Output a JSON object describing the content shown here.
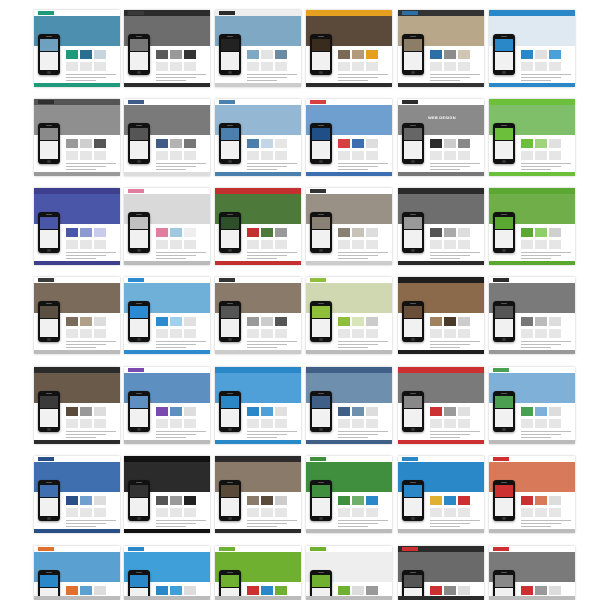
{
  "gallery": {
    "tiles": [
      {
        "brand": "",
        "hero_title": "",
        "header": "#ffffff",
        "hero": "#4d8fae",
        "accent": "#1e9a7a",
        "screen": "#6fa0c0",
        "blocks": [
          "#1e9a7a",
          "#2a6f8f",
          "#c7d5de"
        ],
        "footer": "#1e9a7a",
        "phone": "left"
      },
      {
        "brand": "",
        "hero_title": "",
        "header": "#2b2b2b",
        "hero": "#6d6d6d",
        "accent": "#3a3a3a",
        "screen": "#777777",
        "blocks": [
          "#5a5a5a",
          "#9a9a9a",
          "#333333"
        ],
        "footer": "#2b2b2b",
        "phone": "left"
      },
      {
        "brand": "",
        "hero_title": "",
        "header": "#eeeeee",
        "hero": "#7fa8c5",
        "accent": "#2b2b2b",
        "screen": "#222222",
        "blocks": [
          "#7fa8c5",
          "#e3e3e3",
          "#6c8ba2"
        ],
        "footer": "#cccccc",
        "phone": "left"
      },
      {
        "brand": "",
        "hero_title": "",
        "header": "#e5a020",
        "hero": "#5b4a3a",
        "accent": "#e5a020",
        "screen": "#3a2b1f",
        "blocks": [
          "#7a6a55",
          "#b39a7a",
          "#e5a020"
        ],
        "footer": "#2b2b2b",
        "phone": "left"
      },
      {
        "brand": "",
        "hero_title": "",
        "header": "#333333",
        "hero": "#b8a789",
        "accent": "#2b6fa6",
        "screen": "#8c7d66",
        "blocks": [
          "#2b6fa6",
          "#8c8c8c",
          "#d0c6b3"
        ],
        "footer": "#333333",
        "phone": "left"
      },
      {
        "brand": "",
        "hero_title": "",
        "header": "#2b88c8",
        "hero": "#dfe9f2",
        "accent": "#2b88c8",
        "screen": "#2b88c8",
        "blocks": [
          "#2b88c8",
          "#e0e0e0",
          "#4aa0d8"
        ],
        "footer": "#2b88c8",
        "phone": "left"
      },
      {
        "brand": "",
        "hero_title": "",
        "header": "#555555",
        "hero": "#8f8f8f",
        "accent": "#2f2f2f",
        "screen": "#8a8a8a",
        "blocks": [
          "#9a9a9a",
          "#cfcfcf",
          "#555555"
        ],
        "footer": "#999999",
        "phone": "left"
      },
      {
        "brand": "",
        "hero_title": "",
        "header": "#ffffff",
        "hero": "#7a7a7a",
        "accent": "#3f5b86",
        "screen": "#555555",
        "blocks": [
          "#3f5b86",
          "#b3b3b3",
          "#777777"
        ],
        "footer": "#dddddd",
        "phone": "left"
      },
      {
        "brand": "",
        "hero_title": "",
        "header": "#ffffff",
        "hero": "#94b8d3",
        "accent": "#4a7fae",
        "screen": "#4a7fae",
        "blocks": [
          "#4a7fae",
          "#c2d6e6",
          "#e6e6e6"
        ],
        "footer": "#4a7fae",
        "phone": "left"
      },
      {
        "brand": "",
        "hero_title": "",
        "header": "#ffffff",
        "hero": "#6f9fcf",
        "accent": "#d64040",
        "screen": "#1f4f86",
        "blocks": [
          "#d64040",
          "#3d6fb0",
          "#dddddd"
        ],
        "footer": "#3d6fb0",
        "phone": "left"
      },
      {
        "brand": "",
        "hero_title": "WEB DESIGN",
        "header": "#ffffff",
        "hero": "#8a8a8a",
        "accent": "#2b2b2b",
        "screen": "#666666",
        "blocks": [
          "#2b2b2b",
          "#cccccc",
          "#888888"
        ],
        "footer": "#777777",
        "phone": "left"
      },
      {
        "brand": "",
        "hero_title": "",
        "header": "#6cbf3a",
        "hero": "#7fbf6a",
        "accent": "#6cbf3a",
        "screen": "#6cbf3a",
        "blocks": [
          "#6cbf3a",
          "#9fd47c",
          "#e0e0e0"
        ],
        "footer": "#6cbf3a",
        "phone": "left"
      },
      {
        "brand": "",
        "hero_title": "",
        "header": "#3f3f8f",
        "hero": "#4a56a8",
        "accent": "#3f3f8f",
        "screen": "#4a56a8",
        "blocks": [
          "#4a56a8",
          "#8c9ad0",
          "#c8ccea"
        ],
        "footer": "#3f3f8f",
        "phone": "left"
      },
      {
        "brand": "",
        "hero_title": "",
        "header": "#ffffff",
        "hero": "#d9d9d9",
        "accent": "#e07ea0",
        "screen": "#c0c0c0",
        "blocks": [
          "#e07ea0",
          "#a0c8e0",
          "#eeeeee"
        ],
        "footer": "#bbbbbb",
        "phone": "left"
      },
      {
        "brand": "",
        "hero_title": "",
        "header": "#c23030",
        "hero": "#4d7a3a",
        "accent": "#c23030",
        "screen": "#2f4f2a",
        "blocks": [
          "#c23030",
          "#4d7a3a",
          "#999999"
        ],
        "footer": "#c23030",
        "phone": "left"
      },
      {
        "brand": "",
        "hero_title": "",
        "header": "#ffffff",
        "hero": "#9a9186",
        "accent": "#333333",
        "screen": "#8a8175",
        "blocks": [
          "#8a8175",
          "#c8c2b8",
          "#dddddd"
        ],
        "footer": "#cccccc",
        "phone": "left"
      },
      {
        "brand": "",
        "hero_title": "",
        "header": "#2b2b2b",
        "hero": "#6e6e6e",
        "accent": "#2b2b2b",
        "screen": "#999999",
        "blocks": [
          "#555555",
          "#aaaaaa",
          "#dddddd"
        ],
        "footer": "#2b2b2b",
        "phone": "left"
      },
      {
        "brand": "",
        "hero_title": "",
        "header": "#5aa832",
        "hero": "#6fae48",
        "accent": "#5aa832",
        "screen": "#5aa832",
        "blocks": [
          "#5aa832",
          "#8fcf6a",
          "#d0d0d0"
        ],
        "footer": "#5aa832",
        "phone": "left"
      },
      {
        "brand": "",
        "hero_title": "",
        "header": "#ffffff",
        "hero": "#7a6b5a",
        "accent": "#3a3a3a",
        "screen": "#5a4f42",
        "blocks": [
          "#7a6b5a",
          "#b0a08a",
          "#dddddd"
        ],
        "footer": "#bbbbbb",
        "phone": "left"
      },
      {
        "brand": "",
        "hero_title": "",
        "header": "#ffffff",
        "hero": "#6fb0d8",
        "accent": "#2b8ad0",
        "screen": "#2b8ad0",
        "blocks": [
          "#2b8ad0",
          "#9fd0ee",
          "#e0e0e0"
        ],
        "footer": "#2b8ad0",
        "phone": "left"
      },
      {
        "brand": "",
        "hero_title": "",
        "header": "#ffffff",
        "hero": "#8a7a6a",
        "accent": "#333333",
        "screen": "#555555",
        "blocks": [
          "#999999",
          "#cccccc",
          "#555555"
        ],
        "footer": "#cccccc",
        "phone": "left"
      },
      {
        "brand": "",
        "hero_title": "",
        "header": "#ffffff",
        "hero": "#cfd8b0",
        "accent": "#8fbf3a",
        "screen": "#8fbf3a",
        "blocks": [
          "#8fbf3a",
          "#d8e5b8",
          "#cccccc"
        ],
        "footer": "#bbbbbb",
        "phone": "left"
      },
      {
        "brand": "",
        "hero_title": "",
        "header": "#1f1f1f",
        "hero": "#8a6a4a",
        "accent": "#1f1f1f",
        "screen": "#6a4f38",
        "blocks": [
          "#a0825f",
          "#4a3a2a",
          "#cccccc"
        ],
        "footer": "#1f1f1f",
        "phone": "left"
      },
      {
        "brand": "",
        "hero_title": "",
        "header": "#ffffff",
        "hero": "#7a7a7a",
        "accent": "#2b2b2b",
        "screen": "#555555",
        "blocks": [
          "#777777",
          "#bbbbbb",
          "#dddddd"
        ],
        "footer": "#999999",
        "phone": "left"
      },
      {
        "brand": "",
        "hero_title": "",
        "header": "#2b2b2b",
        "hero": "#6a5a4a",
        "accent": "#2b2b2b",
        "screen": "#3a3a3a",
        "blocks": [
          "#5a4a3a",
          "#999999",
          "#dddddd"
        ],
        "footer": "#2b2b2b",
        "phone": "left"
      },
      {
        "brand": "",
        "hero_title": "",
        "header": "#ffffff",
        "hero": "#5d8fc0",
        "accent": "#7a4ab0",
        "screen": "#5d8fc0",
        "blocks": [
          "#7a4ab0",
          "#5d8fc0",
          "#dddddd"
        ],
        "footer": "#bbbbbb",
        "phone": "left"
      },
      {
        "brand": "",
        "hero_title": "",
        "header": "#2b88c8",
        "hero": "#4fa0d8",
        "accent": "#2b88c8",
        "screen": "#2b88c8",
        "blocks": [
          "#2b88c8",
          "#4fa0d8",
          "#e0e0e0"
        ],
        "footer": "#2b88c8",
        "phone": "left"
      },
      {
        "brand": "",
        "hero_title": "",
        "header": "#3f5f86",
        "hero": "#6f8faf",
        "accent": "#3f5f86",
        "screen": "#3f5f86",
        "blocks": [
          "#3f5f86",
          "#6f8faf",
          "#dddddd"
        ],
        "footer": "#3f5f86",
        "phone": "left"
      },
      {
        "brand": "",
        "hero_title": "",
        "header": "#cc3030",
        "hero": "#7a7a7a",
        "accent": "#cc3030",
        "screen": "#888888",
        "blocks": [
          "#cc3030",
          "#9a9a9a",
          "#e0e0e0"
        ],
        "footer": "#cc3030",
        "phone": "left"
      },
      {
        "brand": "",
        "hero_title": "",
        "header": "#ffffff",
        "hero": "#7fb0d8",
        "accent": "#4aa050",
        "screen": "#4aa050",
        "blocks": [
          "#4aa050",
          "#7fb0d8",
          "#dddddd"
        ],
        "footer": "#bbbbbb",
        "phone": "left"
      },
      {
        "brand": "",
        "hero_title": "",
        "header": "#ffffff",
        "hero": "#3f6fae",
        "accent": "#2a4f86",
        "screen": "#3f6fae",
        "blocks": [
          "#2a4f86",
          "#6f9fcf",
          "#dddddd"
        ],
        "footer": "#2a4f86",
        "phone": "left"
      },
      {
        "brand": "",
        "hero_title": "",
        "header": "#111111",
        "hero": "#2b2b2b",
        "accent": "#111111",
        "screen": "#333333",
        "blocks": [
          "#555555",
          "#999999",
          "#222222"
        ],
        "footer": "#111111",
        "phone": "left"
      },
      {
        "brand": "",
        "hero_title": "",
        "header": "#2b2b2b",
        "hero": "#8a7a6a",
        "accent": "#2b2b2b",
        "screen": "#5a4a3a",
        "blocks": [
          "#8a7a6a",
          "#5a4a3a",
          "#cccccc"
        ],
        "footer": "#2b2b2b",
        "phone": "left"
      },
      {
        "brand": "",
        "hero_title": "",
        "header": "#ffffff",
        "hero": "#3f8f3f",
        "accent": "#3f8f3f",
        "screen": "#3f8f3f",
        "blocks": [
          "#3f8f3f",
          "#6faf6a",
          "#2b88c8"
        ],
        "footer": "#bbbbbb",
        "phone": "left"
      },
      {
        "brand": "",
        "hero_title": "",
        "header": "#ffffff",
        "hero": "#2b88c8",
        "accent": "#2b88c8",
        "screen": "#2b88c8",
        "blocks": [
          "#e0b030",
          "#2b88c8",
          "#cc3030"
        ],
        "footer": "#bbbbbb",
        "phone": "left"
      },
      {
        "brand": "",
        "hero_title": "",
        "header": "#ffffff",
        "hero": "#d87a5a",
        "accent": "#cc3030",
        "screen": "#cc3030",
        "blocks": [
          "#cc3030",
          "#d87a5a",
          "#dddddd"
        ],
        "footer": "#bbbbbb",
        "phone": "left"
      },
      {
        "brand": "",
        "hero_title": "",
        "header": "#ffffff",
        "hero": "#5aa0d0",
        "accent": "#e07030",
        "screen": "#2b88c8",
        "blocks": [
          "#e07030",
          "#5aa0d0",
          "#dddddd"
        ],
        "footer": "#bbbbbb",
        "phone": "left"
      },
      {
        "brand": "",
        "hero_title": "",
        "header": "#ffffff",
        "hero": "#3f9fd8",
        "accent": "#2b88c8",
        "screen": "#2b88c8",
        "blocks": [
          "#2b88c8",
          "#3f9fd8",
          "#dddddd"
        ],
        "footer": "#bbbbbb",
        "phone": "left"
      },
      {
        "brand": "",
        "hero_title": "",
        "header": "#ffffff",
        "hero": "#6fb030",
        "accent": "#6fb030",
        "screen": "#6fb030",
        "blocks": [
          "#cc3030",
          "#2b88c8",
          "#6fb030"
        ],
        "footer": "#bbbbbb",
        "phone": "left"
      },
      {
        "brand": "",
        "hero_title": "",
        "header": "#ffffff",
        "hero": "#eeeeee",
        "accent": "#6fb030",
        "screen": "#6fb030",
        "blocks": [
          "#6fb030",
          "#dddddd",
          "#999999"
        ],
        "footer": "#bbbbbb",
        "phone": "left"
      },
      {
        "brand": "",
        "hero_title": "",
        "header": "#2b2b2b",
        "hero": "#6a6a6a",
        "accent": "#cc3030",
        "screen": "#555555",
        "blocks": [
          "#cc3030",
          "#888888",
          "#dddddd"
        ],
        "footer": "#2b2b2b",
        "phone": "left"
      },
      {
        "brand": "",
        "hero_title": "",
        "header": "#ffffff",
        "hero": "#7a7a7a",
        "accent": "#cc3030",
        "screen": "#888888",
        "blocks": [
          "#cc3030",
          "#999999",
          "#dddddd"
        ],
        "footer": "#bbbbbb",
        "phone": "left"
      }
    ]
  }
}
